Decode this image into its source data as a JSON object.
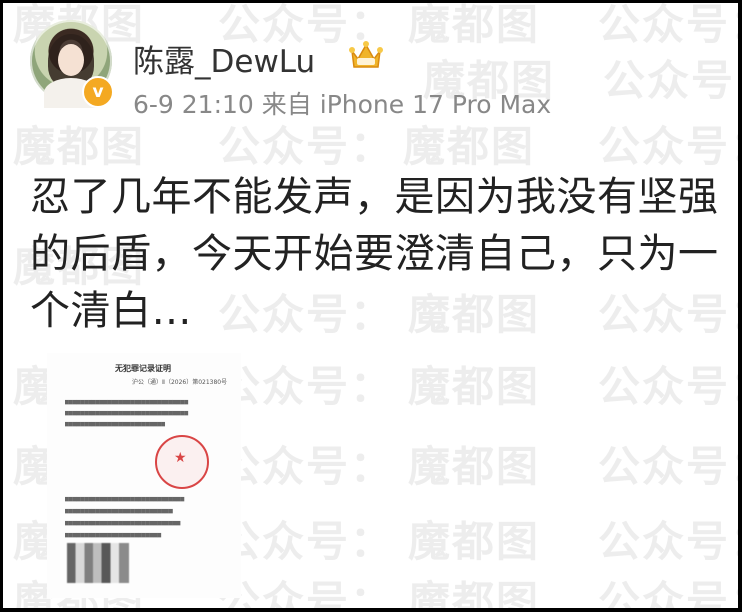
{
  "user": {
    "name": "陈露_DewLu",
    "badge_icon": "crown-icon",
    "verified_icon": "verified-v-icon",
    "verified_mark": "v",
    "colors": {
      "badge": "#f4a922",
      "crown": "#f0b429"
    }
  },
  "meta": {
    "time": "6-9 21:10",
    "source_prefix": "来自",
    "device": "iPhone 17 Pro Max"
  },
  "post": {
    "text": "忍了几年不能发声，是因为我没有坚强的后盾，今天开始要澄清自己，只为一个清白…"
  },
  "attachment": {
    "title": "无犯罪记录证明",
    "number": "沪公（通）Ⅱ（2026）第021380号"
  },
  "watermark": {
    "text_a": "魔都图",
    "text_b": "公众号："
  }
}
